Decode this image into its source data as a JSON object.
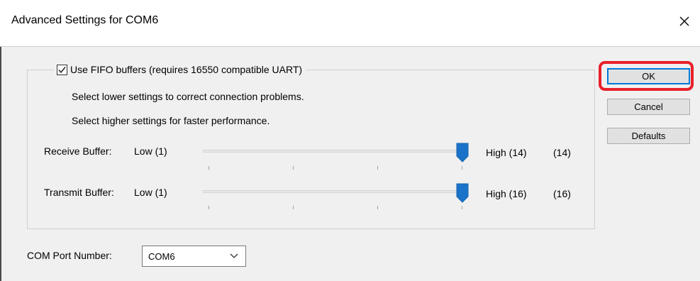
{
  "window": {
    "title": "Advanced Settings for COM6",
    "close_glyph": "✕"
  },
  "fifo": {
    "checkbox_label": "Use FIFO buffers (requires 16550 compatible UART)",
    "checked": true,
    "hint_lower": "Select lower settings to correct connection problems.",
    "hint_higher": "Select higher settings for faster performance."
  },
  "receive": {
    "label": "Receive Buffer:",
    "low_label": "Low (1)",
    "high_label": "High (14)",
    "value_label": "(14)",
    "level_fraction": 1.0
  },
  "transmit": {
    "label": "Transmit Buffer:",
    "low_label": "Low (1)",
    "high_label": "High (16)",
    "value_label": "(16)",
    "level_fraction": 1.0
  },
  "buttons": {
    "ok": "OK",
    "cancel": "Cancel",
    "defaults": "Defaults"
  },
  "com_port": {
    "label": "COM Port Number:",
    "selected": "COM6"
  },
  "colors": {
    "accent": "#0078d7",
    "thumb": "#1a73c8",
    "highlight": "#e8202a"
  },
  "icons": {
    "close": "close-icon",
    "checkmark": "checkmark-icon",
    "dropdown": "chevron-down-icon"
  }
}
